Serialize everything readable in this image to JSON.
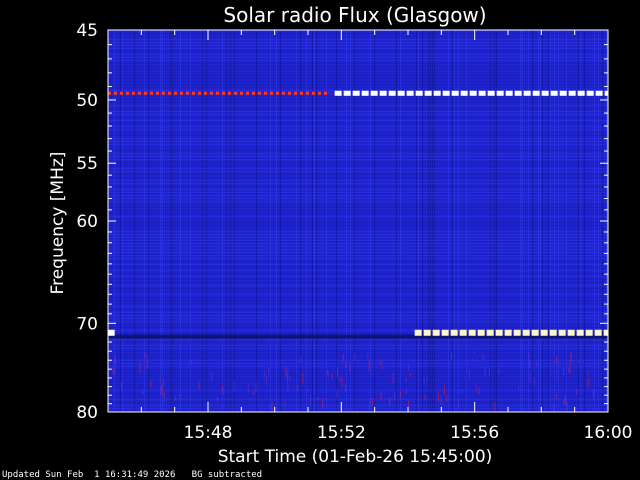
{
  "chart_data": {
    "type": "heatmap",
    "title": "Solar radio Flux (Glasgow)",
    "xlabel": "Start Time (01-Feb-26 15:45:00)",
    "ylabel": "Frequency [MHz]",
    "x_range_minutes": [
      0,
      15
    ],
    "x_ticks": [
      {
        "minute": 3,
        "label": "15:48"
      },
      {
        "minute": 7,
        "label": "15:52"
      },
      {
        "minute": 11,
        "label": "15:56"
      },
      {
        "minute": 15,
        "label": "16:00"
      }
    ],
    "y_range_mhz": [
      45,
      80
    ],
    "y_scale": "log",
    "y_ticks": [
      45,
      50,
      55,
      60,
      70,
      80
    ],
    "background_color": "#1e22c8",
    "interference_bands": [
      {
        "freq_mhz": 49.5,
        "start_min": 0.0,
        "end_min": 6.5,
        "intensity": "low",
        "color": "#ff3a1a"
      },
      {
        "freq_mhz": 49.5,
        "start_min": 6.8,
        "end_min": 15.0,
        "intensity": "high",
        "color": "#ffffff"
      },
      {
        "freq_mhz": 71.0,
        "start_min": 9.2,
        "end_min": 15.0,
        "intensity": "high",
        "color": "#fff6c8"
      },
      {
        "freq_mhz": 71.0,
        "start_min": 0.0,
        "end_min": 0.2,
        "intensity": "high",
        "color": "#ffffff"
      }
    ],
    "colors": {
      "axis": "#ffffff",
      "background": "#000000",
      "hot": "#ff2a00",
      "saturated": "#ffffff"
    }
  },
  "footer": {
    "updated": "Updated Sun Feb  1 16:31:49 2026   BG subtracted"
  }
}
